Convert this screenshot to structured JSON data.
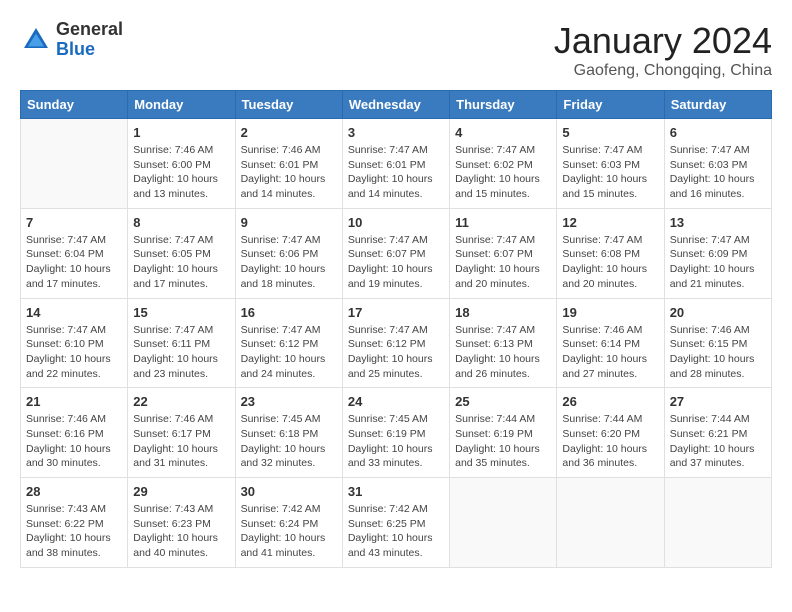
{
  "header": {
    "logo_line1": "General",
    "logo_line2": "Blue",
    "month_title": "January 2024",
    "location": "Gaofeng, Chongqing, China"
  },
  "weekdays": [
    "Sunday",
    "Monday",
    "Tuesday",
    "Wednesday",
    "Thursday",
    "Friday",
    "Saturday"
  ],
  "weeks": [
    [
      {
        "day": "",
        "sunrise": "",
        "sunset": "",
        "daylight": ""
      },
      {
        "day": "1",
        "sunrise": "Sunrise: 7:46 AM",
        "sunset": "Sunset: 6:00 PM",
        "daylight": "Daylight: 10 hours and 13 minutes."
      },
      {
        "day": "2",
        "sunrise": "Sunrise: 7:46 AM",
        "sunset": "Sunset: 6:01 PM",
        "daylight": "Daylight: 10 hours and 14 minutes."
      },
      {
        "day": "3",
        "sunrise": "Sunrise: 7:47 AM",
        "sunset": "Sunset: 6:01 PM",
        "daylight": "Daylight: 10 hours and 14 minutes."
      },
      {
        "day": "4",
        "sunrise": "Sunrise: 7:47 AM",
        "sunset": "Sunset: 6:02 PM",
        "daylight": "Daylight: 10 hours and 15 minutes."
      },
      {
        "day": "5",
        "sunrise": "Sunrise: 7:47 AM",
        "sunset": "Sunset: 6:03 PM",
        "daylight": "Daylight: 10 hours and 15 minutes."
      },
      {
        "day": "6",
        "sunrise": "Sunrise: 7:47 AM",
        "sunset": "Sunset: 6:03 PM",
        "daylight": "Daylight: 10 hours and 16 minutes."
      }
    ],
    [
      {
        "day": "7",
        "sunrise": "Sunrise: 7:47 AM",
        "sunset": "Sunset: 6:04 PM",
        "daylight": "Daylight: 10 hours and 17 minutes."
      },
      {
        "day": "8",
        "sunrise": "Sunrise: 7:47 AM",
        "sunset": "Sunset: 6:05 PM",
        "daylight": "Daylight: 10 hours and 17 minutes."
      },
      {
        "day": "9",
        "sunrise": "Sunrise: 7:47 AM",
        "sunset": "Sunset: 6:06 PM",
        "daylight": "Daylight: 10 hours and 18 minutes."
      },
      {
        "day": "10",
        "sunrise": "Sunrise: 7:47 AM",
        "sunset": "Sunset: 6:07 PM",
        "daylight": "Daylight: 10 hours and 19 minutes."
      },
      {
        "day": "11",
        "sunrise": "Sunrise: 7:47 AM",
        "sunset": "Sunset: 6:07 PM",
        "daylight": "Daylight: 10 hours and 20 minutes."
      },
      {
        "day": "12",
        "sunrise": "Sunrise: 7:47 AM",
        "sunset": "Sunset: 6:08 PM",
        "daylight": "Daylight: 10 hours and 20 minutes."
      },
      {
        "day": "13",
        "sunrise": "Sunrise: 7:47 AM",
        "sunset": "Sunset: 6:09 PM",
        "daylight": "Daylight: 10 hours and 21 minutes."
      }
    ],
    [
      {
        "day": "14",
        "sunrise": "Sunrise: 7:47 AM",
        "sunset": "Sunset: 6:10 PM",
        "daylight": "Daylight: 10 hours and 22 minutes."
      },
      {
        "day": "15",
        "sunrise": "Sunrise: 7:47 AM",
        "sunset": "Sunset: 6:11 PM",
        "daylight": "Daylight: 10 hours and 23 minutes."
      },
      {
        "day": "16",
        "sunrise": "Sunrise: 7:47 AM",
        "sunset": "Sunset: 6:12 PM",
        "daylight": "Daylight: 10 hours and 24 minutes."
      },
      {
        "day": "17",
        "sunrise": "Sunrise: 7:47 AM",
        "sunset": "Sunset: 6:12 PM",
        "daylight": "Daylight: 10 hours and 25 minutes."
      },
      {
        "day": "18",
        "sunrise": "Sunrise: 7:47 AM",
        "sunset": "Sunset: 6:13 PM",
        "daylight": "Daylight: 10 hours and 26 minutes."
      },
      {
        "day": "19",
        "sunrise": "Sunrise: 7:46 AM",
        "sunset": "Sunset: 6:14 PM",
        "daylight": "Daylight: 10 hours and 27 minutes."
      },
      {
        "day": "20",
        "sunrise": "Sunrise: 7:46 AM",
        "sunset": "Sunset: 6:15 PM",
        "daylight": "Daylight: 10 hours and 28 minutes."
      }
    ],
    [
      {
        "day": "21",
        "sunrise": "Sunrise: 7:46 AM",
        "sunset": "Sunset: 6:16 PM",
        "daylight": "Daylight: 10 hours and 30 minutes."
      },
      {
        "day": "22",
        "sunrise": "Sunrise: 7:46 AM",
        "sunset": "Sunset: 6:17 PM",
        "daylight": "Daylight: 10 hours and 31 minutes."
      },
      {
        "day": "23",
        "sunrise": "Sunrise: 7:45 AM",
        "sunset": "Sunset: 6:18 PM",
        "daylight": "Daylight: 10 hours and 32 minutes."
      },
      {
        "day": "24",
        "sunrise": "Sunrise: 7:45 AM",
        "sunset": "Sunset: 6:19 PM",
        "daylight": "Daylight: 10 hours and 33 minutes."
      },
      {
        "day": "25",
        "sunrise": "Sunrise: 7:44 AM",
        "sunset": "Sunset: 6:19 PM",
        "daylight": "Daylight: 10 hours and 35 minutes."
      },
      {
        "day": "26",
        "sunrise": "Sunrise: 7:44 AM",
        "sunset": "Sunset: 6:20 PM",
        "daylight": "Daylight: 10 hours and 36 minutes."
      },
      {
        "day": "27",
        "sunrise": "Sunrise: 7:44 AM",
        "sunset": "Sunset: 6:21 PM",
        "daylight": "Daylight: 10 hours and 37 minutes."
      }
    ],
    [
      {
        "day": "28",
        "sunrise": "Sunrise: 7:43 AM",
        "sunset": "Sunset: 6:22 PM",
        "daylight": "Daylight: 10 hours and 38 minutes."
      },
      {
        "day": "29",
        "sunrise": "Sunrise: 7:43 AM",
        "sunset": "Sunset: 6:23 PM",
        "daylight": "Daylight: 10 hours and 40 minutes."
      },
      {
        "day": "30",
        "sunrise": "Sunrise: 7:42 AM",
        "sunset": "Sunset: 6:24 PM",
        "daylight": "Daylight: 10 hours and 41 minutes."
      },
      {
        "day": "31",
        "sunrise": "Sunrise: 7:42 AM",
        "sunset": "Sunset: 6:25 PM",
        "daylight": "Daylight: 10 hours and 43 minutes."
      },
      {
        "day": "",
        "sunrise": "",
        "sunset": "",
        "daylight": ""
      },
      {
        "day": "",
        "sunrise": "",
        "sunset": "",
        "daylight": ""
      },
      {
        "day": "",
        "sunrise": "",
        "sunset": "",
        "daylight": ""
      }
    ]
  ]
}
